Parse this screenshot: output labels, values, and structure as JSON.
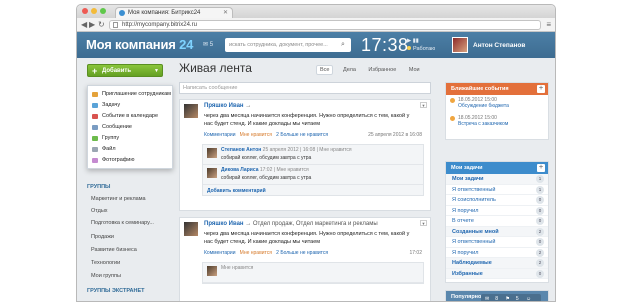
{
  "browser": {
    "tab_title": "Моя компания: Битрикс24",
    "url": "http://mycompany.bitrix24.ru"
  },
  "header": {
    "logo_text": "Моя компания",
    "logo_number": "24",
    "messages_count": "5",
    "search_placeholder": "искать сотрудника, документ, прочее...",
    "time": "17:38",
    "work_status_label": "Работаю",
    "user_name": "Антон Степанов",
    "accent_color": "#4a7ba2"
  },
  "left": {
    "add_button_label": "Добавить",
    "add_menu": [
      "Приглашение сотрудникам",
      "Задачу",
      "Событие в календаре",
      "Сообщение",
      "Группу",
      "Файл",
      "Фотографию"
    ],
    "groups_title": "ГРУППЫ",
    "groups": [
      "Маркетинг и реклама",
      "Отдых",
      "Подготовка к семинару...",
      "Продажи",
      "Развитие бизнеса",
      "Технологии",
      "Мои группы"
    ],
    "extranet_title": "ГРУППЫ ЭКСТРАНЕТ"
  },
  "feed": {
    "title": "Живая лента",
    "filters": [
      "Все",
      "Дела",
      "Избранное",
      "Мои"
    ],
    "message_placeholder": "Написать сообщение",
    "posts": [
      {
        "author": "Пряшко Иван",
        "destination": "",
        "text": "через два месяца начинается конференция. Нужно определиться с тем, какой у нас будет стенд. И какие доклады мы читаем",
        "comments_label": "Комментарии",
        "like_label": "Мне нравится",
        "likes": "2 Больше не нравится",
        "date": "25 апреля 2012 в 16:08",
        "comments": [
          {
            "author": "Степанов Антон",
            "meta": "25 апреля 2012 | 16:08 | Мне нравится",
            "text": "собирай коллег, обсудим завтра с утра"
          },
          {
            "author": "Дикова Лариса",
            "meta": "17:02 | Мне нравится",
            "text": "собирай коллег, обсудим завтра с утра"
          }
        ],
        "add_comment": "Добавить комментарий"
      },
      {
        "author": "Пряшко Иван",
        "destination": "Отдел продаж, Отдел маркетинга и рекламы",
        "text": "через два месяца начинается конференция. Нужно определиться с тем, какой у нас будет стенд. И какие доклады мы читаем",
        "comments_label": "Комментарии",
        "like_label": "Мне нравится",
        "likes": "2 Больше не нравится",
        "date": "17:02",
        "comments": [
          {
            "author": "",
            "meta": "Мне нравится",
            "text": ""
          }
        ]
      }
    ]
  },
  "right": {
    "events_title": "Ближайшие события",
    "events": [
      {
        "date": "18.05.2012 15:00",
        "title": "Обсуждение бюджета"
      },
      {
        "date": "18.05.2012 15:00",
        "title": "Встреча с заказчиком"
      }
    ],
    "tasks_title": "Мои задачи",
    "tasks": [
      {
        "label": "Мои задачи",
        "count": "1",
        "bold": true
      },
      {
        "label": "Я ответственный",
        "count": "1",
        "bold": false
      },
      {
        "label": "Я соисполнитель",
        "count": "0",
        "bold": false
      },
      {
        "label": "Я поручил",
        "count": "0",
        "bold": false
      },
      {
        "label": "В отчете",
        "count": "0",
        "bold": false
      },
      {
        "label": "Созданные мной",
        "count": "2",
        "bold": true
      },
      {
        "label": "Я ответственный",
        "count": "0",
        "bold": false
      },
      {
        "label": "Я поручил",
        "count": "2",
        "bold": false
      },
      {
        "label": "Наблюдаемые",
        "count": "2",
        "bold": true
      },
      {
        "label": "Избранные",
        "count": "0",
        "bold": true
      }
    ],
    "popular_title": "Популярное",
    "chat_counts": [
      "8",
      "5",
      "25"
    ]
  }
}
